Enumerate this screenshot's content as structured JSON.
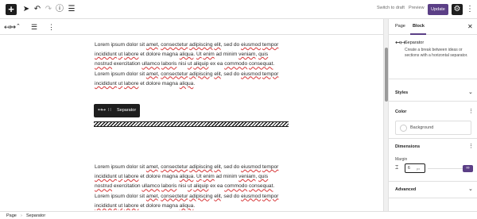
{
  "topbar": {
    "add_icon": "plus-icon",
    "tools": [
      "select-tool-icon",
      "undo-icon",
      "redo-icon",
      "info-icon",
      "list-view-icon"
    ],
    "switch_to_draft": "Switch to draft",
    "preview": "Preview",
    "update": "Update",
    "settings_icon": "gear-icon",
    "more_icon": "kebab-icon",
    "accent_color": "#5b3f86"
  },
  "blockbar": {
    "items": [
      "separator-icon",
      "move-updown-icon",
      "align-icon",
      "more-options-icon"
    ]
  },
  "content": {
    "paragraph1": [
      [
        "Lorem ipsum dolor sit ",
        {
          "u": "amet"
        },
        ", ",
        {
          "u": "consectetur"
        },
        " ",
        {
          "u": "adipiscing"
        },
        " ",
        {
          "u": "elit"
        },
        ", sed do ",
        {
          "u": "eiusmod"
        },
        " ",
        {
          "u": "tempor"
        }
      ],
      [
        {
          "u": "incididunt"
        },
        " ",
        {
          "u": "ut"
        },
        " ",
        {
          "u": "labore"
        },
        " et dolore magna ",
        {
          "u": "aliqua"
        },
        ". ",
        {
          "u": "Ut"
        },
        " ",
        {
          "u": "enim"
        },
        " ad minim ",
        {
          "u": "veniam"
        },
        ", ",
        {
          "u": "quis"
        }
      ],
      [
        {
          "u": "nostrud"
        },
        " exercitation ",
        {
          "u": "ullamco"
        },
        " ",
        {
          "u": "laboris"
        },
        " nisi ",
        {
          "u": "ut"
        },
        " ",
        {
          "u": "aliquip"
        },
        " ex ea ",
        {
          "u": "commodo"
        },
        " ",
        {
          "u": "consequat"
        },
        "."
      ],
      [
        "Lorem ipsum dolor sit ",
        {
          "u": "amet"
        },
        ", ",
        {
          "u": "consectetur"
        },
        " ",
        {
          "u": "adipiscing"
        },
        " ",
        {
          "u": "elit"
        },
        ", sed do ",
        {
          "u": "eiusmod"
        },
        " ",
        {
          "u": "tempor"
        }
      ],
      [
        {
          "u": "incididunt"
        },
        " ",
        {
          "u": "ut"
        },
        " ",
        {
          "u": "labore"
        },
        " et dolore magna ",
        {
          "u": "aliqua"
        },
        "."
      ]
    ],
    "paragraph2": [
      [
        "Lorem ipsum dolor sit ",
        {
          "u": "amet"
        },
        ", ",
        {
          "u": "consectetur"
        },
        " ",
        {
          "u": "adipiscing"
        },
        " ",
        {
          "u": "elit"
        },
        ", sed do ",
        {
          "u": "eiusmod"
        },
        " ",
        {
          "u": "tempor"
        }
      ],
      [
        {
          "u": "incididunt"
        },
        " ",
        {
          "u": "ut"
        },
        " ",
        {
          "u": "labore"
        },
        " et dolore magna ",
        {
          "u": "aliqua"
        },
        ". ",
        {
          "u": "Ut"
        },
        " ",
        {
          "u": "enim"
        },
        " ad minim ",
        {
          "u": "veniam"
        },
        ", ",
        {
          "u": "quis"
        }
      ],
      [
        {
          "u": "nostrud"
        },
        " exercitation ",
        {
          "u": "ullamco"
        },
        " ",
        {
          "u": "laboris"
        },
        " nisi ",
        {
          "u": "ut"
        },
        " ",
        {
          "u": "aliquip"
        },
        " ex ea ",
        {
          "u": "commodo"
        },
        " ",
        {
          "u": "consequat"
        },
        "."
      ],
      [
        "Lorem ipsum dolor sit ",
        {
          "u": "amet"
        },
        ", ",
        {
          "u": "consectetur"
        },
        " ",
        {
          "u": "adipiscing"
        },
        " ",
        {
          "u": "elit"
        },
        ", sed do ",
        {
          "u": "eiusmod"
        },
        " ",
        {
          "u": "tempor"
        }
      ],
      [
        {
          "u": "incididunt"
        },
        " ",
        {
          "u": "ut"
        },
        " ",
        {
          "u": "labore"
        },
        " et dolore magna ",
        {
          "u": "aliqua"
        },
        "."
      ]
    ],
    "floating_toolbar": {
      "label": "Separator",
      "icon": "separator-icon",
      "drag_icon": "drag-handle-icon"
    }
  },
  "sidebar": {
    "tabs": [
      "Page",
      "Block"
    ],
    "active_tab": "Block",
    "close_icon": "close-icon",
    "block": {
      "title": "Separator",
      "description": "Create a break between ideas or sections with a horizontal separator."
    },
    "panels": {
      "styles": "Styles",
      "color": "Color",
      "background": "Background",
      "dimensions": "Dimensions",
      "margin_label": "Margin",
      "margin_value": "6",
      "margin_unit": "px",
      "advanced": "Advanced"
    }
  },
  "footer": {
    "breadcrumbs": [
      "Page",
      "Separator"
    ]
  }
}
